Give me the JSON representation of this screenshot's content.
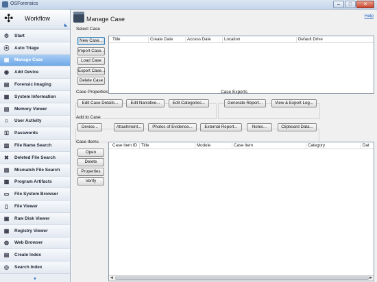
{
  "window": {
    "title": "OSForensics",
    "minimize": "–",
    "maximize": "□",
    "close": "✕"
  },
  "sidebar": {
    "title": "Workflow",
    "items": [
      {
        "label": "Start",
        "icon": "start-icon",
        "glyph": "⚙"
      },
      {
        "label": "Auto Triage",
        "icon": "fingerprint-icon",
        "glyph": "⦿"
      },
      {
        "label": "Manage Case",
        "icon": "briefcase-icon",
        "glyph": "▣",
        "active": true
      },
      {
        "label": "Add Device",
        "icon": "add-device-icon",
        "glyph": "◉"
      },
      {
        "label": "Forensic Imaging",
        "icon": "imaging-icon",
        "glyph": "▤"
      },
      {
        "label": "System Information",
        "icon": "system-info-icon",
        "glyph": "▦"
      },
      {
        "label": "Memory Viewer",
        "icon": "memory-icon",
        "glyph": "▥"
      },
      {
        "label": "User Activity",
        "icon": "user-activity-icon",
        "glyph": "☺"
      },
      {
        "label": "Passwords",
        "icon": "key-icon",
        "glyph": "⚿"
      },
      {
        "label": "File Name Search",
        "icon": "file-search-icon",
        "glyph": "▧"
      },
      {
        "label": "Deleted File Search",
        "icon": "deleted-file-icon",
        "glyph": "✖"
      },
      {
        "label": "Mismatch File Search",
        "icon": "mismatch-icon",
        "glyph": "▨"
      },
      {
        "label": "Program Artifacts",
        "icon": "program-artifacts-icon",
        "glyph": "▩"
      },
      {
        "label": "File System Browser",
        "icon": "folder-icon",
        "glyph": "▭"
      },
      {
        "label": "File Viewer",
        "icon": "file-viewer-icon",
        "glyph": "▯"
      },
      {
        "label": "Raw Disk Viewer",
        "icon": "raw-disk-icon",
        "glyph": "▣"
      },
      {
        "label": "Registry Viewer",
        "icon": "registry-icon",
        "glyph": "▦"
      },
      {
        "label": "Web Browser",
        "icon": "globe-icon",
        "glyph": "◍"
      },
      {
        "label": "Create Index",
        "icon": "create-index-icon",
        "glyph": "▤"
      },
      {
        "label": "Search Index",
        "icon": "search-index-icon",
        "glyph": "◎"
      }
    ]
  },
  "main": {
    "title": "Manage Case",
    "help": "Help",
    "select_case": {
      "label": "Select Case",
      "buttons": [
        "New Case...",
        "Import Case...",
        "Load Case",
        "Export Case...",
        "Delete Case"
      ],
      "columns": [
        "Title",
        "Create Date",
        "Access Date",
        "Location",
        "Default Drive"
      ]
    },
    "case_properties": {
      "label": "Case Properties",
      "buttons": [
        "Edit Case Details...",
        "Edit Narrative...",
        "Edit Categories..."
      ]
    },
    "case_exports": {
      "label": "Case Exports",
      "buttons": [
        "Generate Report...",
        "View & Export Log..."
      ]
    },
    "add_to_case": {
      "label": "Add to Case",
      "buttons": [
        "Device...",
        "Attachment...",
        "Photos of Evidence...",
        "External Report...",
        "Notes...",
        "Clipboard Data..."
      ]
    },
    "case_items": {
      "label": "Case Items",
      "buttons": [
        "Open",
        "Delete",
        "Properties",
        "Verify"
      ],
      "columns": [
        "Case Item ID",
        "Title",
        "Module",
        "Case Item",
        "Category",
        "Dat"
      ]
    }
  }
}
